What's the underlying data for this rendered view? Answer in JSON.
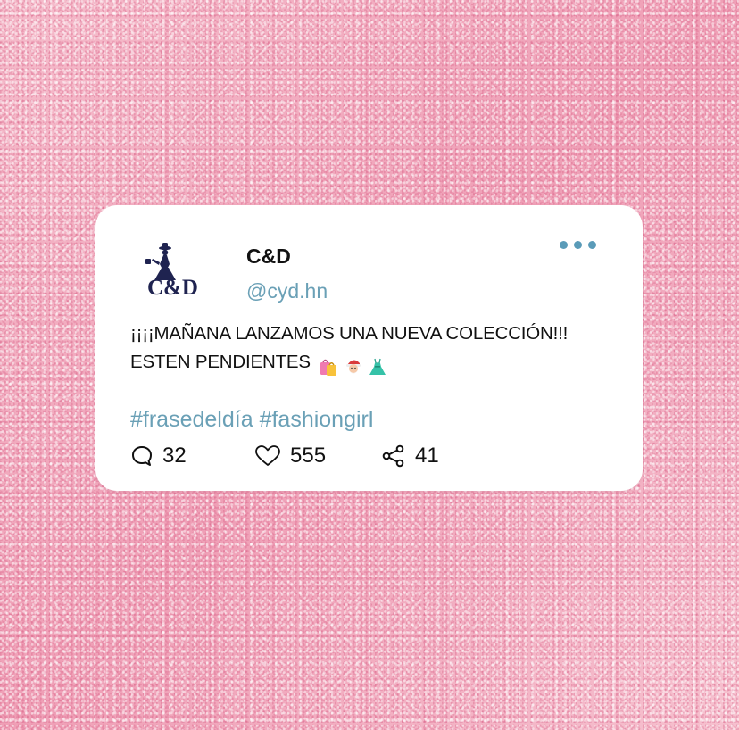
{
  "tweet": {
    "display_name": "C&D",
    "handle": "@cyd.hn",
    "text": "¡¡¡¡MAÑANA LANZAMOS UNA NUEVA COLECCIÓN!!! ESTEN PENDIENTES",
    "emojis": [
      "shopping-bags",
      "santa",
      "dress"
    ],
    "hashtags": [
      "#frasedeldía",
      "#fashiongirl"
    ],
    "stats": {
      "replies": "32",
      "likes": "555",
      "shares": "41"
    }
  },
  "logo": {
    "text": "C&D",
    "color": "#1f2350"
  },
  "colors": {
    "background": "#f2b3c5",
    "card": "#ffffff",
    "accent": "#6aa0b6",
    "dots": "#5a9bb8",
    "text": "#111111"
  },
  "icons": {
    "more": "more-dots-icon",
    "replies": "comment-icon",
    "likes": "heart-icon",
    "shares": "share-icon"
  }
}
